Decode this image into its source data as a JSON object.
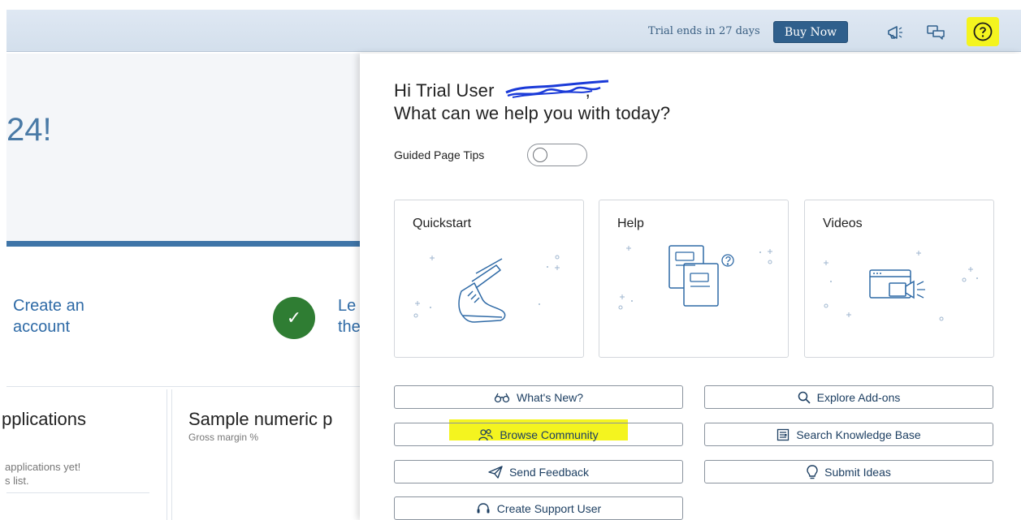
{
  "shell": {
    "trial_text": "Trial ends in 27 days",
    "buy_label": "Buy Now",
    "icons": [
      "megaphone-icon",
      "chat-icon",
      "help-icon"
    ],
    "highlight_color": "#f4f41f"
  },
  "background": {
    "hero_text": "24!",
    "step1": {
      "line1": "Create an",
      "line2": "account"
    },
    "step2": {
      "line1": "Le",
      "line2": "the"
    },
    "card_left": {
      "title": "pplications",
      "line1": "applications yet!",
      "line2": "s list."
    },
    "card_mid": {
      "title": "Sample numeric p",
      "subtitle": "Gross margin %"
    }
  },
  "help": {
    "greeting_line1": "Hi Trial User",
    "greeting_comma": ",",
    "greeting_line2": "What can we help you with today?",
    "guided_label": "Guided Page Tips",
    "tiles": [
      {
        "title": "Quickstart",
        "icon": "shoe-icon"
      },
      {
        "title": "Help",
        "icon": "documents-icon"
      },
      {
        "title": "Videos",
        "icon": "video-icon"
      }
    ],
    "links": {
      "whats_new": "What's New?",
      "explore_addons": "Explore Add-ons",
      "browse_community": "Browse Community",
      "search_kb": "Search Knowledge Base",
      "send_feedback": "Send Feedback",
      "submit_ideas": "Submit Ideas",
      "create_support": "Create Support User"
    }
  }
}
